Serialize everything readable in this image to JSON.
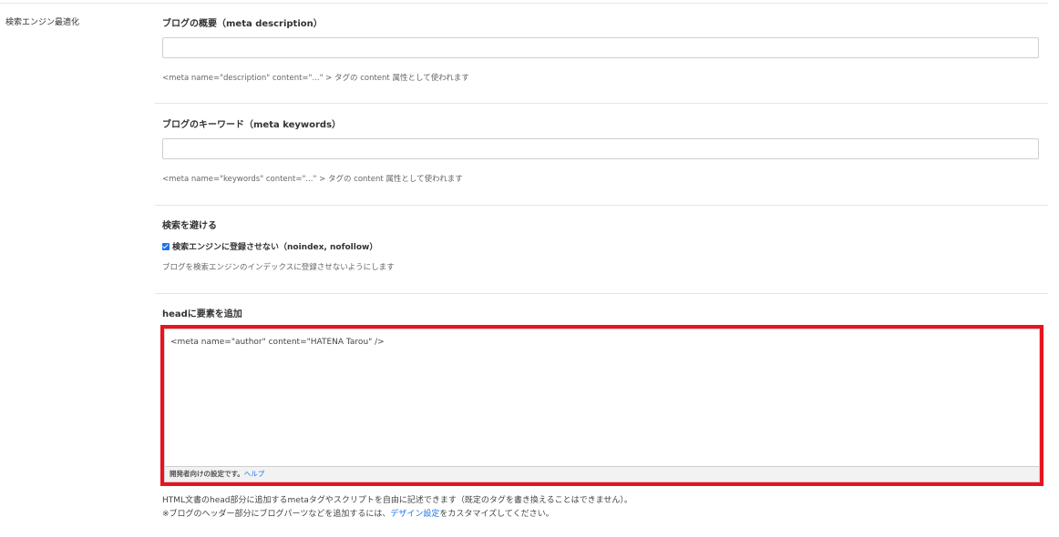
{
  "sidebar": {
    "label": "検索エンジン最適化"
  },
  "meta_description": {
    "heading": "ブログの概要（meta description）",
    "value": "",
    "help": "<meta name=\"description\" content=\"...\" > タグの content 属性として使われます"
  },
  "meta_keywords": {
    "heading": "ブログのキーワード（meta keywords）",
    "value": "",
    "help": "<meta name=\"keywords\" content=\"...\" > タグの content 属性として使われます"
  },
  "avoid_search": {
    "heading": "検索を避ける",
    "checkbox_label": "検索エンジンに登録させない（noindex, nofollow）",
    "checked": true,
    "help": "ブログを検索エンジンのインデックスに登録させないようにします"
  },
  "head_elements": {
    "heading": "headに要素を追加",
    "value": "<meta name=\"author\" content=\"HATENA Tarou\" />",
    "footer_note": "開発者向けの設定です。",
    "footer_link": "ヘルプ",
    "help_line1": "HTML文書のhead部分に追加するmetaタグやスクリプトを自由に記述できます（既定のタグを書き換えることはできません）。",
    "help_line2_prefix": "※ブログのヘッダー部分にブログパーツなどを追加するには、",
    "help_line2_link": "デザイン設定",
    "help_line2_suffix": "をカスタマイズしてください。"
  },
  "colors": {
    "highlight": "#e8131f",
    "link": "#1a73e8"
  }
}
